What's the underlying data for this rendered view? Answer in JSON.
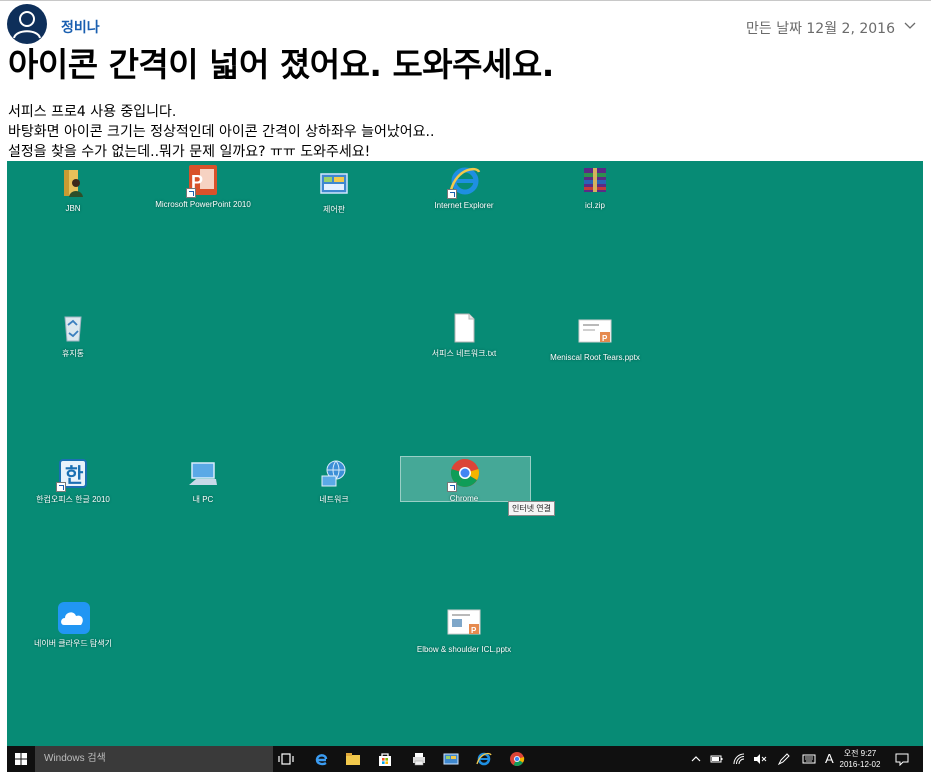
{
  "post": {
    "author": "정비나",
    "date": "만든 날짜 12월 2, 2016",
    "title": "아이콘 간격이 넓어 졌어요. 도와주세요.",
    "body_lines": [
      "서피스 프로4 사용 중입니다.",
      "바탕화면 아이콘 크기는 정상적인데 아이콘 간격이 상하좌우 늘어났어요..",
      "설정을 찾을 수가 없는데..뭐가 문제 일까요? ㅠㅠ 도와주세요!"
    ]
  },
  "desktop": {
    "background_color": "#078b75",
    "icons": [
      {
        "label": "JBN",
        "icon": "user-folder-icon"
      },
      {
        "label": "Microsoft PowerPoint 2010",
        "icon": "powerpoint-icon"
      },
      {
        "label": "제어판",
        "icon": "control-panel-icon"
      },
      {
        "label": "Internet Explorer",
        "icon": "internet-explorer-icon"
      },
      {
        "label": "icl.zip",
        "icon": "winrar-archive-icon"
      },
      {
        "label": "휴지통",
        "icon": "recycle-bin-icon"
      },
      {
        "label": "서피스 네트워크.txt",
        "icon": "text-file-icon"
      },
      {
        "label": "Meniscal Root Tears.pptx",
        "icon": "pptx-file-icon"
      },
      {
        "label": "한컴오피스 한글 2010",
        "icon": "hwp-icon"
      },
      {
        "label": "내 PC",
        "icon": "this-pc-icon"
      },
      {
        "label": "네트워크",
        "icon": "network-icon"
      },
      {
        "label": "Chrome",
        "icon": "chrome-icon"
      },
      {
        "label": "네이버 클라우드 탐색기",
        "icon": "naver-cloud-icon"
      },
      {
        "label": "Elbow & shoulder ICL.pptx",
        "icon": "pptx-file-icon"
      }
    ],
    "tooltip": "인터넷 연결"
  },
  "taskbar": {
    "search_placeholder": "Windows 검색",
    "ime": "A",
    "clock_time": "오전 9:27",
    "clock_date": "2016-12-02"
  }
}
